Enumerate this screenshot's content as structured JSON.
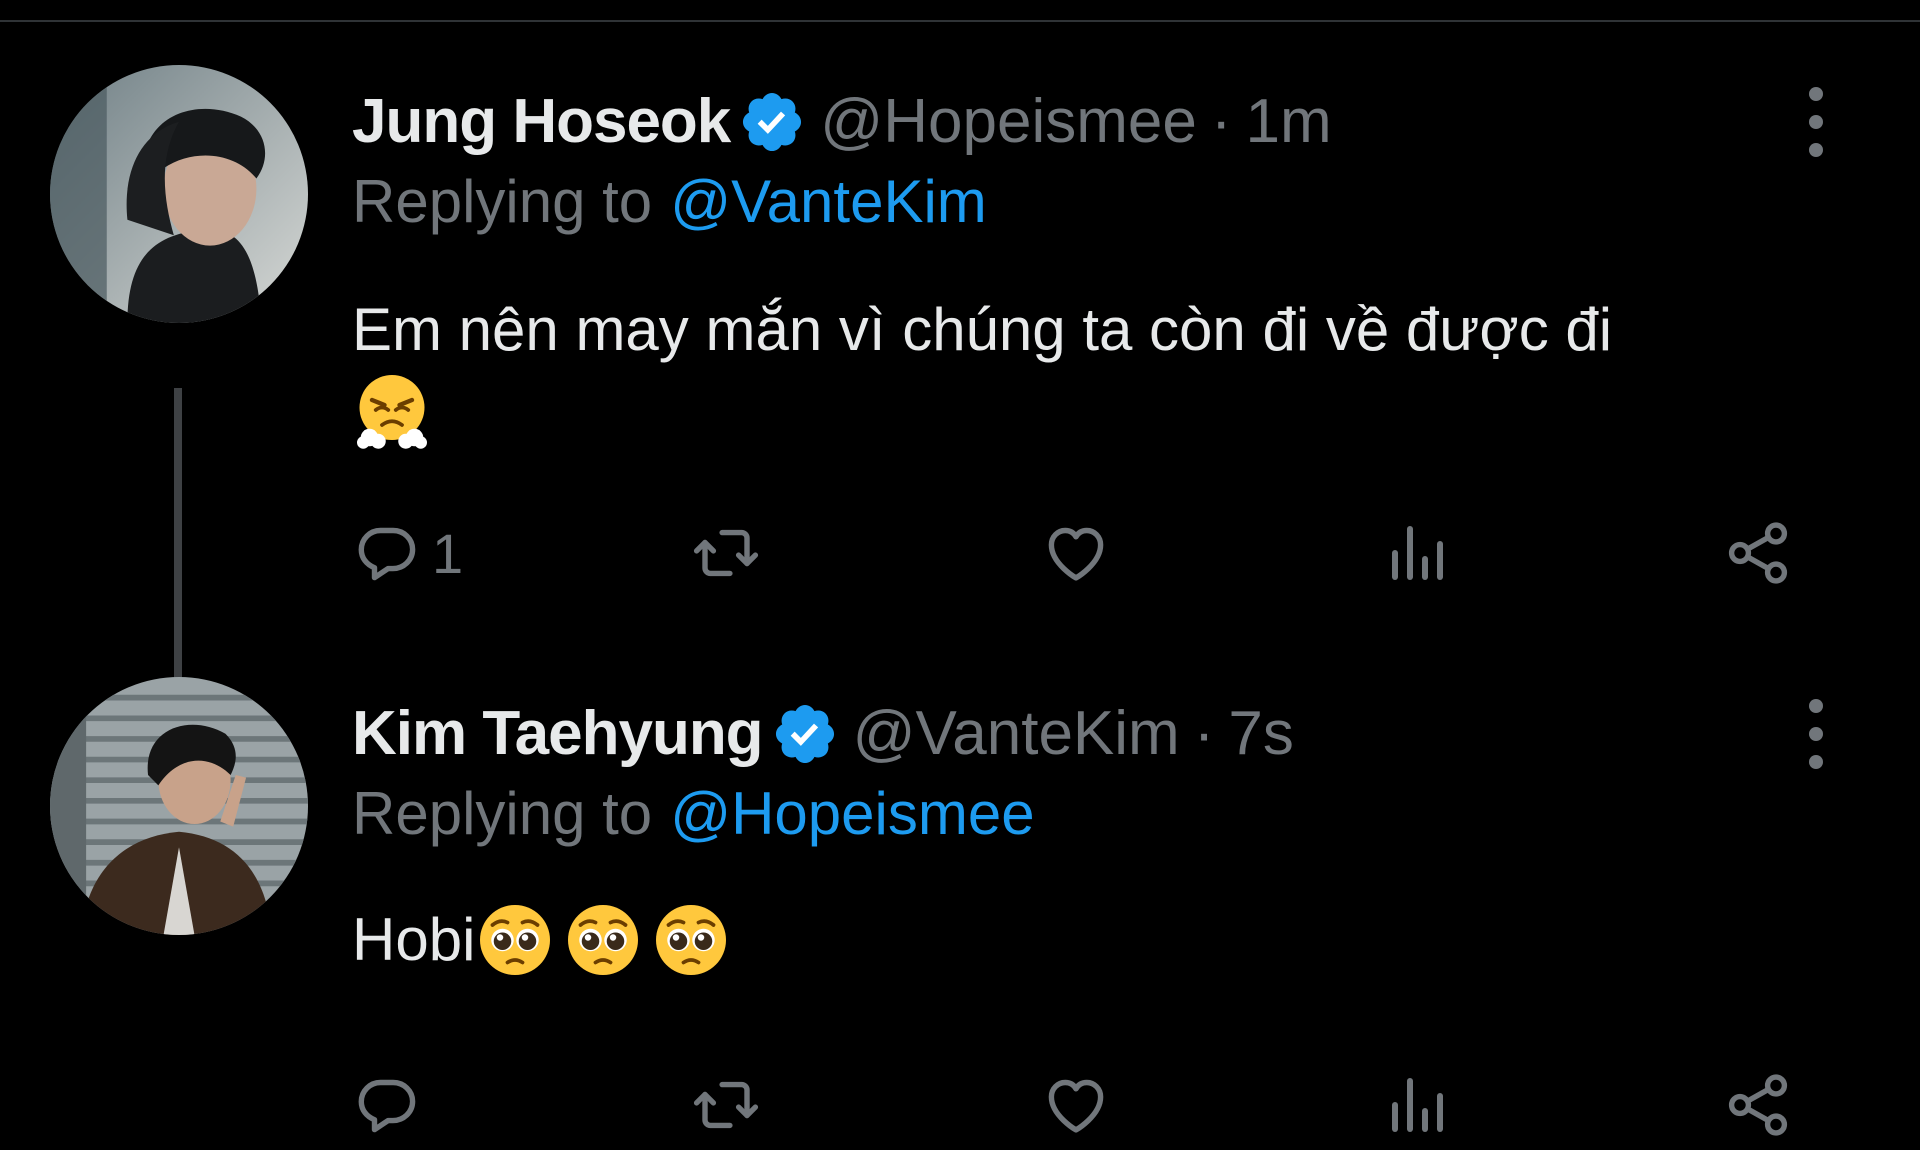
{
  "colors": {
    "background": "#000000",
    "text_primary": "#e7e9ea",
    "text_secondary": "#71767b",
    "accent": "#1d9bf0"
  },
  "tweets": [
    {
      "display_name": "Jung Hoseok",
      "handle": "@Hopeismee",
      "separator": "·",
      "time": "1m",
      "replying_prefix": "Replying to",
      "replying_to": "@VanteKim",
      "text": "Em nên may mắn vì chúng ta còn đi về được đi",
      "emojis": [
        "huffing-face-icon"
      ],
      "reply_count": "1"
    },
    {
      "display_name": "Kim Taehyung",
      "handle": "@VanteKim",
      "separator": "·",
      "time": "7s",
      "replying_prefix": "Replying to",
      "replying_to": "@Hopeismee",
      "text": "Hobi",
      "emojis": [
        "pleading-face-icon",
        "pleading-face-icon",
        "pleading-face-icon"
      ],
      "reply_count": ""
    }
  ]
}
